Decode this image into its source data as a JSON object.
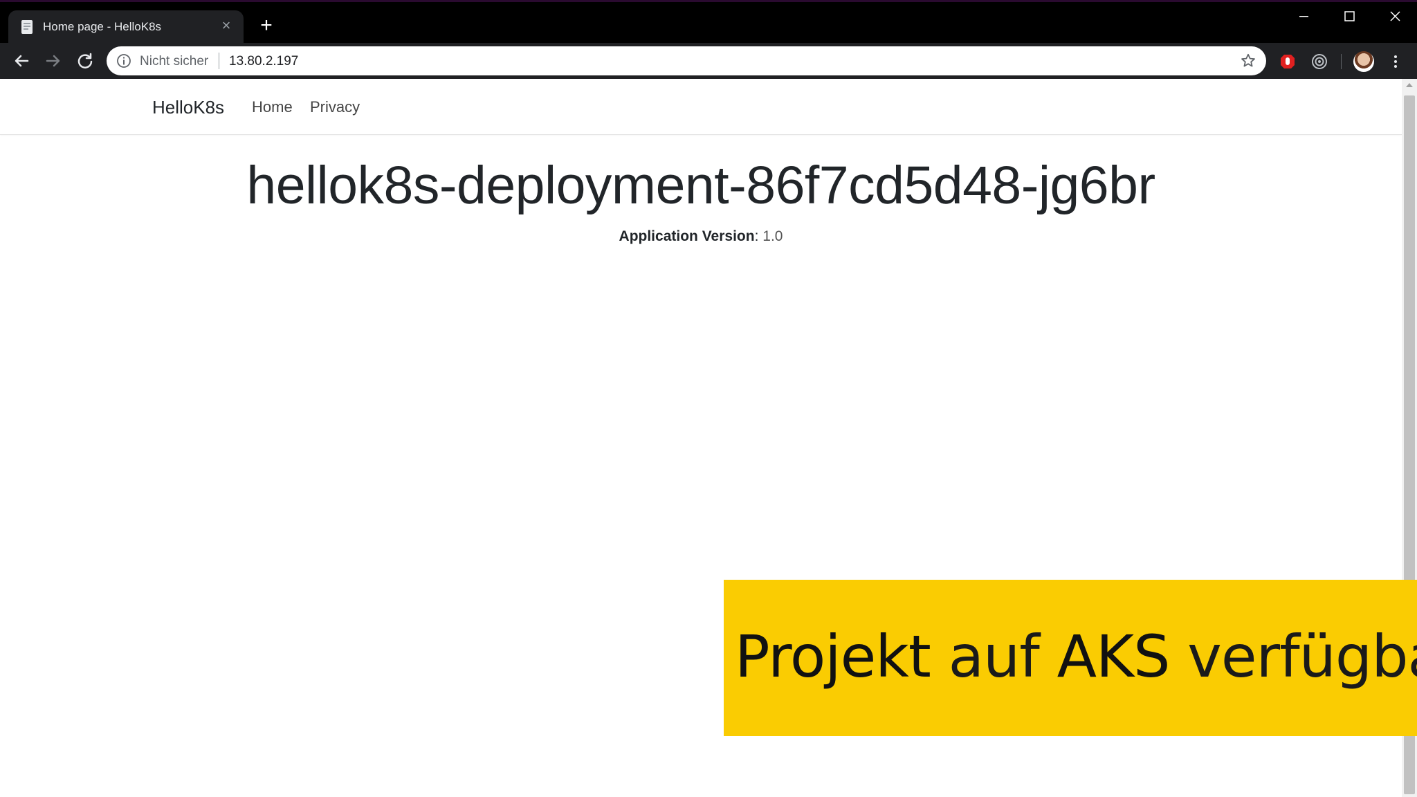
{
  "browser": {
    "tab": {
      "title": "Home page - HelloK8s",
      "close_glyph": "×"
    },
    "new_tab_glyph": "+",
    "address_bar": {
      "security_label": "Nicht sicher",
      "url": "13.80.2.197"
    },
    "icons": [
      "document-favicon-icon",
      "back-arrow-icon",
      "forward-arrow-icon",
      "reload-icon",
      "info-icon",
      "star-icon",
      "red-extension-icon",
      "target-extension-icon",
      "avatar",
      "kebab-menu-icon",
      "minimize-icon",
      "maximize-icon",
      "close-window-icon"
    ]
  },
  "site": {
    "brand": "HelloK8s",
    "nav": {
      "home": "Home",
      "privacy": "Privacy"
    },
    "heading": "hellok8s-deployment-86f7cd5d48-jg6br",
    "version_label": "Application Version",
    "version_separator": ":",
    "version_value": "1.0"
  },
  "caption": {
    "word1": "Projekt",
    "word2": "auf",
    "word3": "AKS",
    "word4": "verfügbar",
    "background": "#facc02"
  },
  "colors": {
    "titlebar": "#000000",
    "toolbar": "#202124",
    "page_background": "#ffffff",
    "text": "#212529"
  }
}
